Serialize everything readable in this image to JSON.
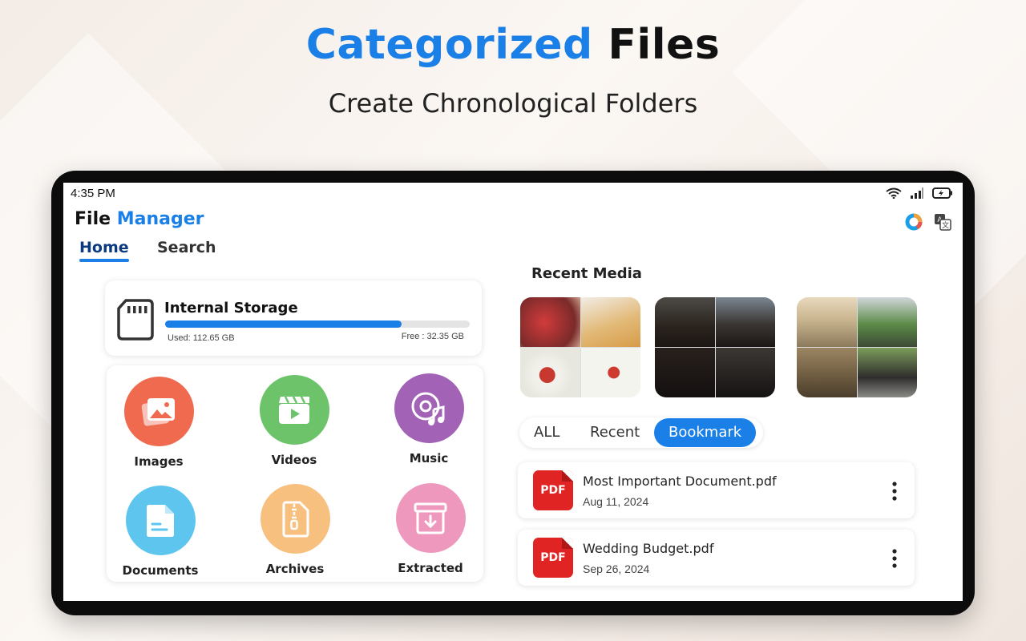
{
  "headline": {
    "accent": "Categorized",
    "rest": "Files"
  },
  "subline": "Create Chronological Folders",
  "status_bar": {
    "time": "4:35 PM",
    "icons": [
      "wifi-icon",
      "signal-icon",
      "battery-charging-icon"
    ]
  },
  "app": {
    "title_part1": "File",
    "title_part2": "Manager",
    "header_icons": [
      "storage-chart-icon",
      "translate-icon"
    ]
  },
  "tabs": [
    {
      "label": "Home",
      "active": true
    },
    {
      "label": "Search",
      "active": false
    }
  ],
  "storage": {
    "label": "Internal Storage",
    "used": "Used: 112.65 GB",
    "free": "Free : 32.35 GB",
    "used_fraction": 0.777,
    "icon": "sd-card-icon"
  },
  "categories": [
    {
      "label": "Images",
      "color": "#f06a50",
      "icon": "image-icon"
    },
    {
      "label": "Videos",
      "color": "#6cc36a",
      "icon": "video-icon"
    },
    {
      "label": "Music",
      "color": "#a263b6",
      "icon": "music-icon"
    },
    {
      "label": "Documents",
      "color": "#5ec6ee",
      "icon": "document-icon"
    },
    {
      "label": "Archives",
      "color": "#f8c07f",
      "icon": "archive-icon"
    },
    {
      "label": "Extracted",
      "color": "#ee98bd",
      "icon": "extract-icon"
    }
  ],
  "recent_media": {
    "title": "Recent Media"
  },
  "filters": [
    {
      "label": "ALL",
      "active": false
    },
    {
      "label": "Recent",
      "active": false
    },
    {
      "label": "Bookmark",
      "active": true
    }
  ],
  "files": [
    {
      "name": "Most Important Document.pdf",
      "date": "Aug 11, 2024",
      "badge": "PDF"
    },
    {
      "name": "Wedding Budget.pdf",
      "date": "Sep 26, 2024",
      "badge": "PDF"
    }
  ],
  "colors": {
    "accent": "#1a7fe6",
    "pdf": "#e02424"
  }
}
